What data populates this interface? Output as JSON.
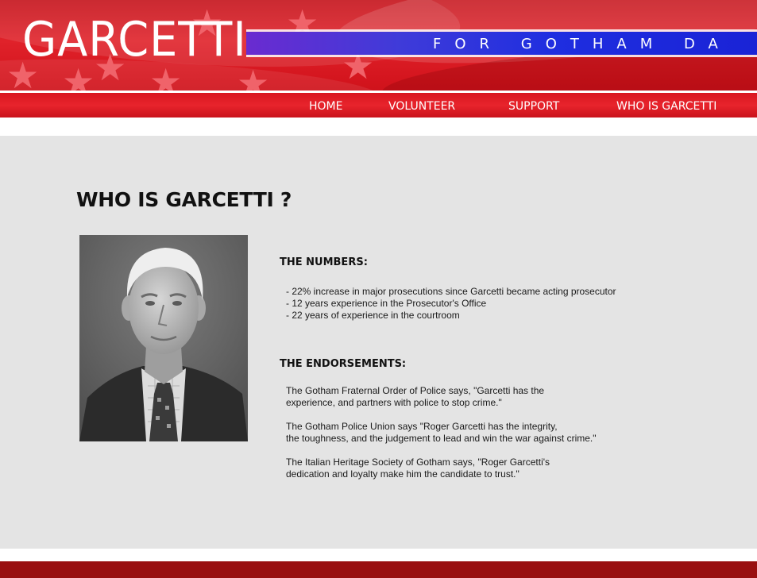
{
  "header": {
    "logo": "GARCETTI",
    "tagline": "FOR GOTHAM DA"
  },
  "nav": {
    "items": [
      {
        "label": "HOME"
      },
      {
        "label": "VOLUNTEER"
      },
      {
        "label": "SUPPORT"
      },
      {
        "label": "WHO IS GARCETTI"
      }
    ]
  },
  "main": {
    "title": "WHO IS GARCETTI ?",
    "portrait_alt": "Portrait of Roger Garcetti",
    "numbers": {
      "heading": "THE NUMBERS:",
      "items": [
        "-   22% increase in major prosecutions since Garcetti became acting prosecutor",
        "-   12 years experience in the Prosecutor's Office",
        "-   22 years of experience in the courtroom"
      ]
    },
    "endorsements": {
      "heading": "THE ENDORSEMENTS:",
      "items": [
        {
          "line1": "The Gotham Fraternal Order of Police says, \"Garcetti has the",
          "line2": "experience, and partners with police to stop crime.\""
        },
        {
          "line1": "The Gotham Police Union says \"Roger Garcetti has the integrity,",
          "line2": "the toughness, and the judgement to lead and win the war against crime.\""
        },
        {
          "line1": "The Italian Heritage Society of Gotham says, \"Roger Garcetti's",
          "line2": "dedication and loyalty make him the candidate to trust.\""
        }
      ]
    }
  },
  "colors": {
    "header_red": "#d3141d",
    "tagline_blue": "#1a23d6",
    "content_bg": "#e4e4e4",
    "footer_red": "#990f10"
  }
}
